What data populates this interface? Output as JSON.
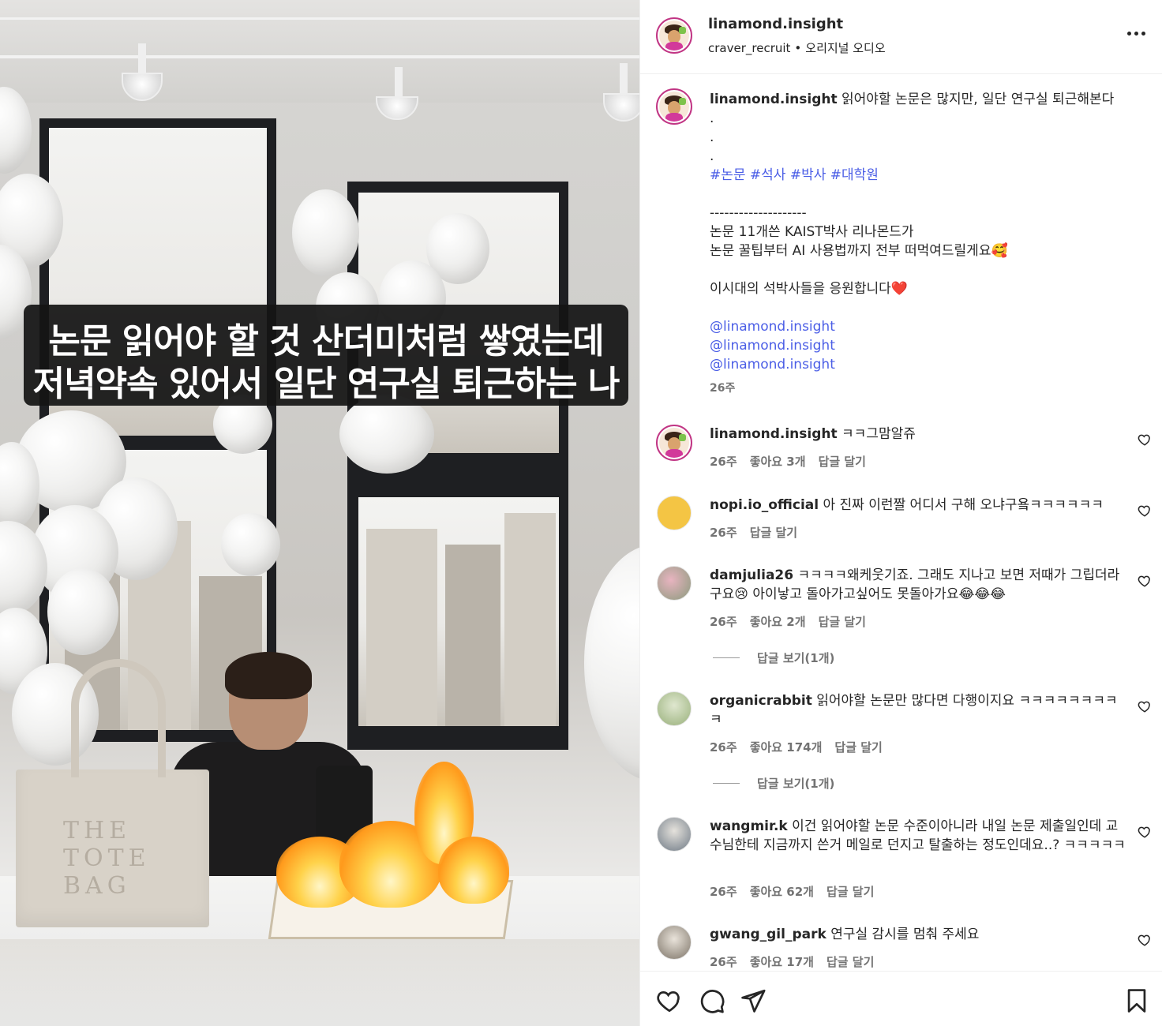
{
  "header": {
    "username": "linamond.insight",
    "sub_user": "craver_recruit",
    "sub_sep": "•",
    "sub_audio": "오리지널 오디오"
  },
  "media": {
    "caption_line1": "논문 읽어야 할 것 산더미처럼 쌓였는데",
    "caption_line2": "저녁약속 있어서 일단 연구실 퇴근하는 나",
    "bag_text": "THE TOTE BAG"
  },
  "post": {
    "username": "linamond.insight",
    "lines": [
      "읽어야할 논문은 많지만, 일단 연구실 퇴근해본다",
      ".",
      ".",
      "."
    ],
    "hashtags": "#논문 #석사 #박사 #대학원",
    "divider": "--------------------",
    "body_lines": [
      "논문 11개쓴 KAIST박사 리나몬드가",
      "논문 꿀팁부터 AI 사용법까지 전부 떠먹여드릴게요🥰",
      "",
      "이시대의 석박사들을 응원합니다❤️",
      ""
    ],
    "mentions": [
      "@linamond.insight",
      "@linamond.insight",
      "@linamond.insight"
    ],
    "time": "26주"
  },
  "comments": [
    {
      "username": "linamond.insight",
      "text": "ㅋㅋ그맘알쥬",
      "time": "26주",
      "likes": "좋아요 3개",
      "reply": "답글 달기",
      "view_replies": ""
    },
    {
      "username": "nopi.io_official",
      "text": "아 진짜 이런짤 어디서 구해 오냐구욬ㅋㅋㅋㅋㅋㅋ",
      "time": "26주",
      "likes": "",
      "reply": "답글 달기",
      "view_replies": ""
    },
    {
      "username": "damjulia26",
      "text": "ㅋㅋㅋㅋ왜케웃기죠. 그래도 지나고 보면 저때가 그립더라구요😢 아이낳고 돌아가고싶어도 못돌아가요😂😂😂",
      "time": "26주",
      "likes": "좋아요 2개",
      "reply": "답글 달기",
      "view_replies": "답글 보기(1개)"
    },
    {
      "username": "organicrabbit",
      "text": "읽어야할 논문만 많다면 다행이지요 ㅋㅋㅋㅋㅋㅋㅋㅋㅋ",
      "time": "26주",
      "likes": "좋아요 174개",
      "reply": "답글 달기",
      "view_replies": "답글 보기(1개)"
    },
    {
      "username": "wangmir.k",
      "text": "이건 읽어야할 논문 수준이아니라 내일 논문 제출일인데 교수님한테 지금까지 쓴거 메일로 던지고 탈출하는 정도인데요..? ㅋㅋㅋㅋㅋ",
      "time": "26주",
      "likes": "좋아요 62개",
      "reply": "답글 달기",
      "view_replies": ""
    },
    {
      "username": "gwang_gil_park",
      "text": "연구실 감시를 멈춰 주세요",
      "time": "26주",
      "likes": "좋아요 17개",
      "reply": "답글 달기",
      "view_replies": ""
    }
  ],
  "icons": {
    "like": "heart-icon",
    "comment": "comment-icon",
    "share": "send-icon",
    "save": "bookmark-icon",
    "more": "more-horizontal-icon"
  },
  "colors": {
    "link": "#4b5ee6",
    "story_ring": "#c13584",
    "meta_text": "#737373"
  }
}
